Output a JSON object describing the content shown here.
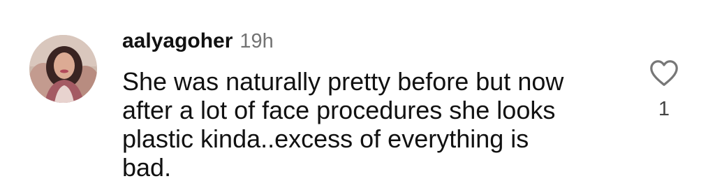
{
  "comment": {
    "username": "aalyagoher",
    "timestamp": "19h",
    "text": "She was naturally pretty before but now\nafter a lot of face procedures she looks\nplastic kinda..excess of everything is\nbad.",
    "avatar_icon": "profile-photo",
    "like_icon": "heart-outline-icon",
    "like_count": "1"
  }
}
